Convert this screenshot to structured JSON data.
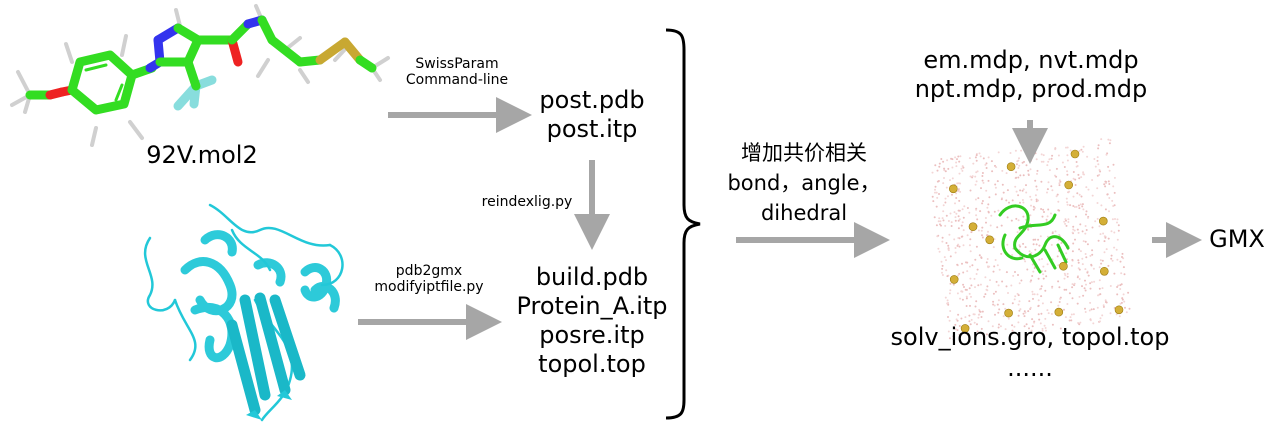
{
  "ligand": {
    "file_label": "92V.mol2",
    "tool_label_line1": "SwissParam",
    "tool_label_line2": "Command-line"
  },
  "ligand_outputs": {
    "line1": "post.pdb",
    "line2": "post.itp"
  },
  "reindex": {
    "label": "reindexlig.py"
  },
  "protein": {
    "tool_label_line1": "pdb2gmx",
    "tool_label_line2": "modifyiptfile.py"
  },
  "build_outputs": {
    "line1": "build.pdb",
    "line2": "Protein_A.itp",
    "line3": "posre.itp",
    "line4": "topol.top"
  },
  "merge_step": {
    "line1": "增加共价相关",
    "line2": "bond，angle，",
    "line3": "dihedral"
  },
  "mdp_files": {
    "line1": "em.mdp, nvt.mdp",
    "line2": "npt.mdp, prod.mdp"
  },
  "system": {
    "line1": "solv_ions.gro, topol.top",
    "line2": "......"
  },
  "final": {
    "label": "GMX"
  },
  "colors": {
    "arrow": "#a6a6a6",
    "ligand_carbon": "#33dd22",
    "nitrogen": "#3333ee",
    "oxygen": "#ee2222",
    "sulfur": "#c8a832",
    "fluorine": "#88dddd",
    "protein_ribbon": "#22c8d8",
    "ion": "#d4af37",
    "water": "#e8b4b4",
    "complex_protein": "#33cc22"
  }
}
